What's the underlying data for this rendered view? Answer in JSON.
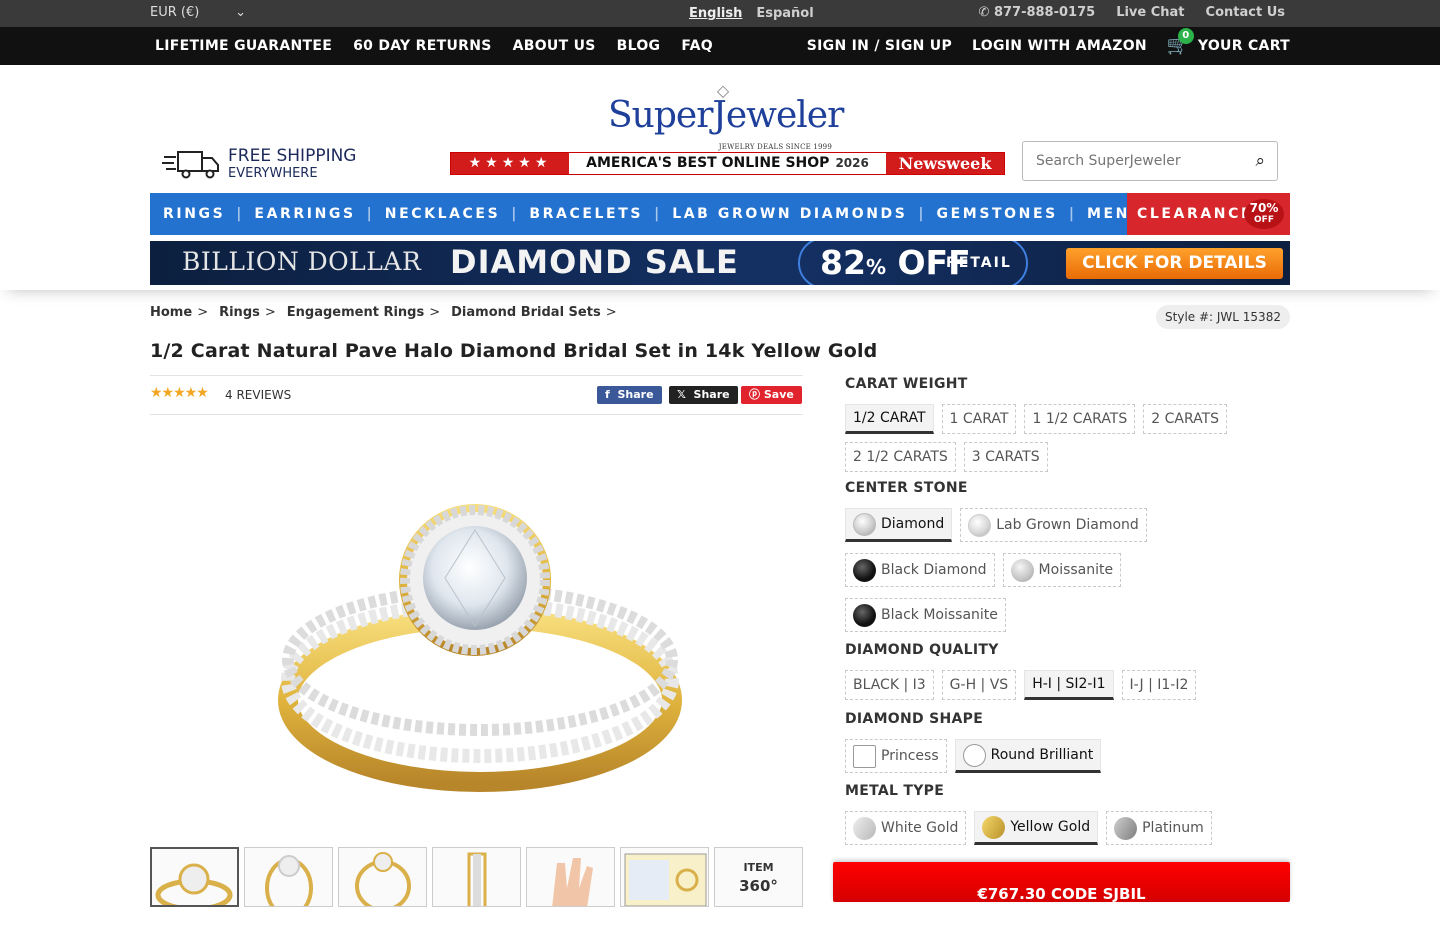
{
  "topbar": {
    "currency": "EUR (€)",
    "languages": [
      "English",
      "Español"
    ],
    "phone": "877-888-0175",
    "live_chat": "Live Chat",
    "contact": "Contact Us"
  },
  "navbar": {
    "left": [
      "LIFETIME GUARANTEE",
      "60 DAY RETURNS",
      "ABOUT US",
      "BLOG",
      "FAQ"
    ],
    "signin": "SIGN IN / SIGN UP",
    "amazon": "LOGIN WITH AMAZON",
    "cart_count": "0",
    "cart": "YOUR CART"
  },
  "header": {
    "brand": "SuperJeweler",
    "tagline": "JEWELRY DEALS SINCE 1999",
    "shipping_line1": "FREE SHIPPING",
    "shipping_line2": "EVERYWHERE",
    "award_stars": "★★★★★",
    "award_text": "AMERICA'S BEST ONLINE SHOP",
    "award_year": "2026",
    "award_brand": "Newsweek",
    "search_placeholder": "Search SuperJeweler"
  },
  "categories": [
    "RINGS",
    "EARRINGS",
    "NECKLACES",
    "BRACELETS",
    "LAB GROWN DIAMONDS",
    "GEMSTONES",
    "MENS"
  ],
  "clearance": {
    "label": "CLEARANCE",
    "pct": "70%",
    "off": "OFF"
  },
  "banner": {
    "line1": "BILLION DOLLAR",
    "line2": "DIAMOND SALE",
    "pct": "82",
    "pct_sign": "%",
    "off": " OFF",
    "retail": "RETAIL",
    "cta": "CLICK FOR DETAILS"
  },
  "breadcrumb": [
    "Home",
    "Rings",
    "Engagement Rings",
    "Diamond Bridal Sets"
  ],
  "style_number": "Style #: JWL 15382",
  "product": {
    "title": "1/2 Carat Natural Pave Halo Diamond Bridal Set in 14k Yellow Gold",
    "stars": "★★★★★",
    "reviews": "4 REVIEWS",
    "share_fb": "Share",
    "share_x": "Share",
    "share_pin": "Save",
    "thumb_item_label": "ITEM",
    "thumb_360": "360°"
  },
  "options": {
    "carat_heading": "CARAT WEIGHT",
    "carat": [
      "1/2 CARAT",
      "1 CARAT",
      "1 1/2 CARATS",
      "2 CARATS",
      "2 1/2 CARATS",
      "3 CARATS"
    ],
    "stone_heading": "CENTER STONE",
    "stone": [
      "Diamond",
      "Lab Grown Diamond",
      "Black Diamond",
      "Moissanite",
      "Black Moissanite"
    ],
    "quality_heading": "DIAMOND QUALITY",
    "quality": [
      "BLACK | I3",
      "G-H | VS",
      "H-I | SI2-I1",
      "I-J | I1-I2"
    ],
    "shape_heading": "DIAMOND SHAPE",
    "shape": [
      "Princess",
      "Round Brilliant"
    ],
    "metal_heading": "METAL TYPE",
    "metal": [
      "White Gold",
      "Yellow Gold",
      "Platinum"
    ]
  },
  "price_bar": "€767.30 CODE SJBIL",
  "colors": {
    "nav_blue": "#2472cf",
    "clearance_red": "#d7262c",
    "topbar": "#3a3a3a",
    "navbar": "#111111"
  }
}
